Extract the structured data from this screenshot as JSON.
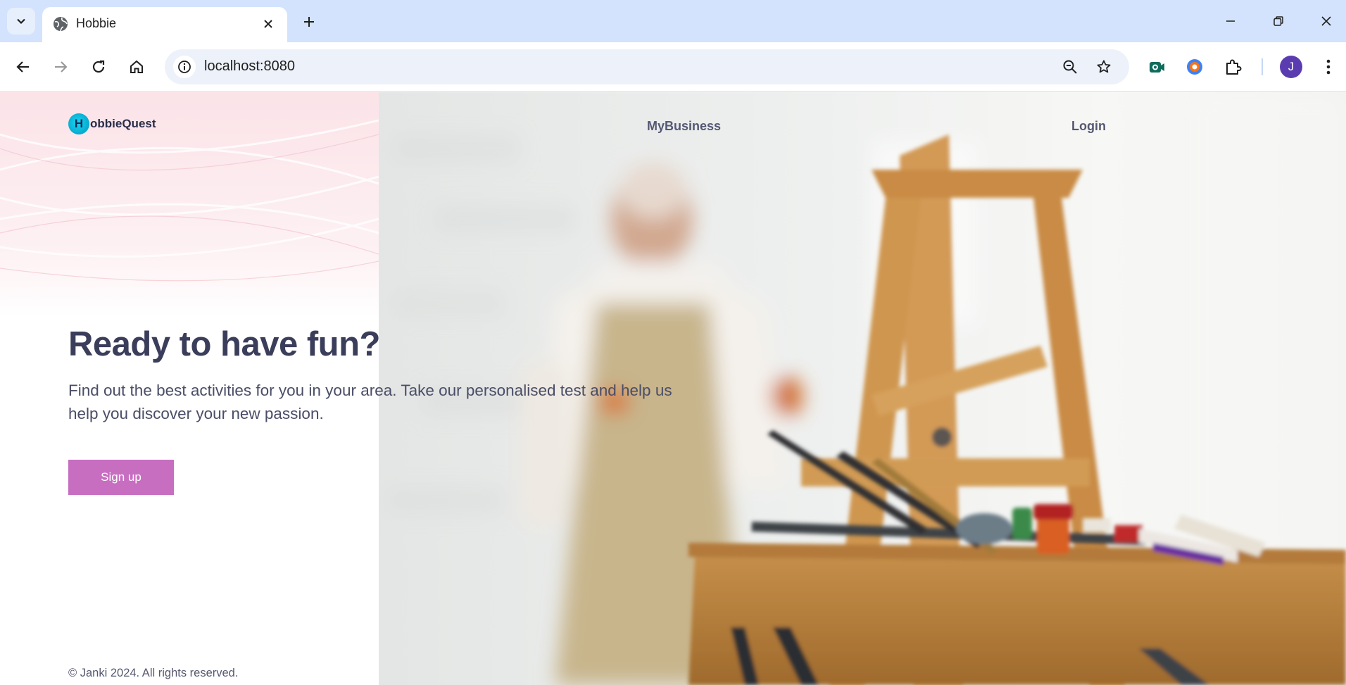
{
  "browser": {
    "tab_title": "Hobbie",
    "url": "localhost:8080",
    "profile_initial": "J"
  },
  "site": {
    "logo_letter": "H",
    "logo_text": "obbieQuest",
    "nav": {
      "business": "MyBusiness",
      "login": "Login"
    },
    "hero": {
      "headline": "Ready to have fun?",
      "subtext": "Find out the best activities for you in your area. Take our personalised test and help us help you discover your new passion.",
      "cta": "Sign up"
    },
    "footer": "© Janki 2024. All rights reserved."
  },
  "colors": {
    "accent": "#c76ec1",
    "heading": "#3b3e5b",
    "chrome": "#d3e3fd"
  },
  "icons": [
    "tab-list-icon",
    "globe-icon",
    "close-icon",
    "plus-icon",
    "minimize-icon",
    "restore-icon",
    "back-icon",
    "forward-icon",
    "reload-icon",
    "home-icon",
    "info-icon",
    "zoom-icon",
    "star-icon",
    "extension-puzzle-icon",
    "menu-dots-icon"
  ]
}
